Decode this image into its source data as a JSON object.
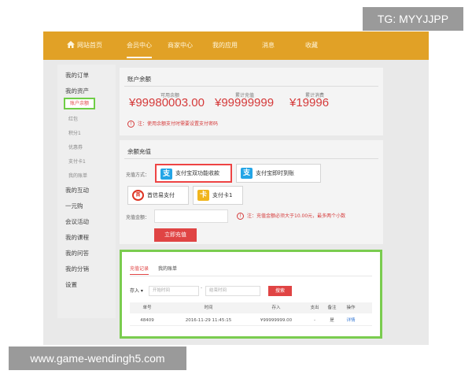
{
  "watermark_top": "TG: MYYJJPP",
  "watermark_bottom": "www.game-wendingh5.com",
  "nav": {
    "home": "网站首页",
    "items": [
      "会员中心",
      "商家中心",
      "我的应用",
      "消息",
      "收藏"
    ]
  },
  "sidebar": {
    "items": [
      "我的订单",
      "我的资产"
    ],
    "active_sub": "账户余额",
    "subs": [
      "红包",
      "积分1",
      "优惠券",
      "支付卡1",
      "我的账单"
    ],
    "items2": [
      "我的互动",
      "一元购",
      "会议活动",
      "我的课程",
      "我的问答",
      "我的分销",
      "设置"
    ]
  },
  "balance": {
    "title": "账户余额",
    "available_label": "可用余额",
    "available_value": "¥99980003.00",
    "recharge_label": "累计充值",
    "recharge_value": "¥99999999",
    "spend_label": "累计消费",
    "spend_value": "¥19996",
    "note_icon": "!",
    "note": "注：使用余额支付时需要设置支付密码"
  },
  "recharge": {
    "title": "余额充值",
    "method_label": "充值方式：",
    "methods": [
      "支付宝双功能收款",
      "支付宝即时到账",
      "首信易支付",
      "支付卡1"
    ],
    "method_icons": [
      "支",
      "支",
      "首",
      "卡"
    ],
    "amount_label": "充值金额：",
    "amount_note": "注：充值金额必须大于10.00元，最多两个小数",
    "submit": "立即充值"
  },
  "records": {
    "tabs": [
      "充值记录",
      "我的账单"
    ],
    "filter_value": "存入 ▾",
    "start_placeholder": "开始时间",
    "date_separator": "-",
    "end_placeholder": "结束时间",
    "search": "搜索",
    "columns": [
      "单号",
      "时间",
      "存入",
      "支出",
      "备注",
      "操作"
    ],
    "rows": [
      [
        "48409",
        "2016-11-29 11:45:15",
        "¥99999999.00",
        "-",
        "是",
        "详情"
      ]
    ]
  }
}
